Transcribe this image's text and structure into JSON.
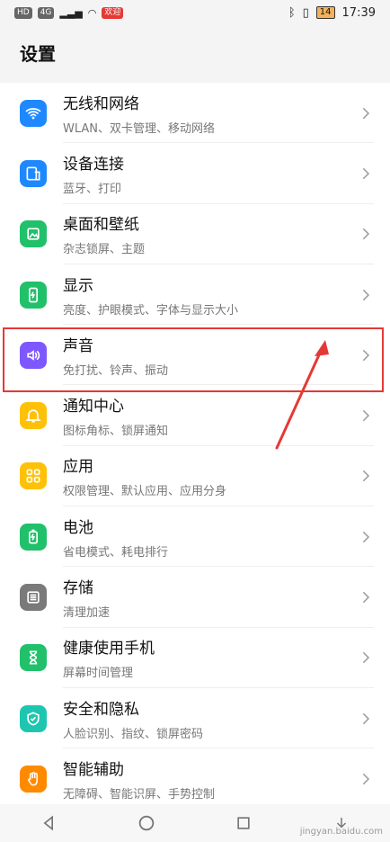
{
  "status_bar": {
    "left_chips": [
      "HD",
      "4G",
      "欢迎"
    ],
    "time": "17:39",
    "battery": "14"
  },
  "header": {
    "title": "设置"
  },
  "settings": [
    {
      "title": "无线和网络",
      "subtitle": "WLAN、双卡管理、移动网络",
      "icon": "wifi-icon",
      "color": "#1e88ff"
    },
    {
      "title": "设备连接",
      "subtitle": "蓝牙、打印",
      "icon": "device-connect-icon",
      "color": "#1e88ff"
    },
    {
      "title": "桌面和壁纸",
      "subtitle": "杂志锁屏、主题",
      "icon": "wallpaper-icon",
      "color": "#21c06a"
    },
    {
      "title": "显示",
      "subtitle": "亮度、护眼模式、字体与显示大小",
      "icon": "display-icon",
      "color": "#21c06a"
    },
    {
      "title": "声音",
      "subtitle": "免打扰、铃声、振动",
      "icon": "sound-icon",
      "color": "#7e57ff"
    },
    {
      "title": "通知中心",
      "subtitle": "图标角标、锁屏通知",
      "icon": "bell-icon",
      "color": "#ffc107"
    },
    {
      "title": "应用",
      "subtitle": "权限管理、默认应用、应用分身",
      "icon": "apps-icon",
      "color": "#ffc107"
    },
    {
      "title": "电池",
      "subtitle": "省电模式、耗电排行",
      "icon": "battery-icon",
      "color": "#21c06a"
    },
    {
      "title": "存储",
      "subtitle": "清理加速",
      "icon": "storage-icon",
      "color": "#7a7a7a"
    },
    {
      "title": "健康使用手机",
      "subtitle": "屏幕时间管理",
      "icon": "hourglass-icon",
      "color": "#21c06a"
    },
    {
      "title": "安全和隐私",
      "subtitle": "人脸识别、指纹、锁屏密码",
      "icon": "shield-icon",
      "color": "#1ec6b0"
    },
    {
      "title": "智能辅助",
      "subtitle": "无障碍、智能识屏、手势控制",
      "icon": "hand-icon",
      "color": "#ff8a00"
    }
  ],
  "nav": {
    "back": "back-icon",
    "home": "home-icon",
    "recents": "recents-icon"
  },
  "watermark": "jingyan.baidu.com"
}
